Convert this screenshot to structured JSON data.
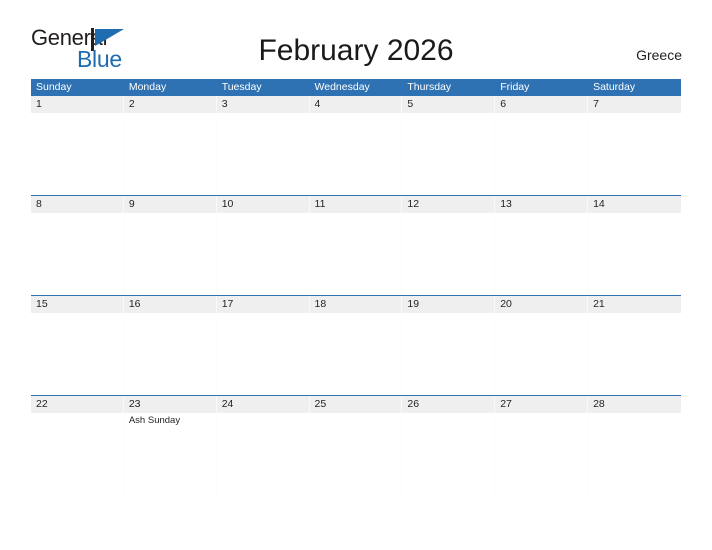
{
  "brand": {
    "name_part1": "General",
    "name_part2": "Blue",
    "flag_icon": "flag-triangle-icon",
    "accent_color": "#1f6cb0"
  },
  "header": {
    "title": "February 2026",
    "region": "Greece"
  },
  "theme": {
    "header_blue": "#2E72B3",
    "date_band_gray": "#EFEFEF",
    "text_dark": "#231f20",
    "page_background": "#ffffff"
  },
  "calendar": {
    "month": "February",
    "year": "2026",
    "weekdays": [
      "Sunday",
      "Monday",
      "Tuesday",
      "Wednesday",
      "Thursday",
      "Friday",
      "Saturday"
    ],
    "weeks": [
      {
        "days": [
          {
            "date": "1",
            "events": []
          },
          {
            "date": "2",
            "events": []
          },
          {
            "date": "3",
            "events": []
          },
          {
            "date": "4",
            "events": []
          },
          {
            "date": "5",
            "events": []
          },
          {
            "date": "6",
            "events": []
          },
          {
            "date": "7",
            "events": []
          }
        ]
      },
      {
        "days": [
          {
            "date": "8",
            "events": []
          },
          {
            "date": "9",
            "events": []
          },
          {
            "date": "10",
            "events": []
          },
          {
            "date": "11",
            "events": []
          },
          {
            "date": "12",
            "events": []
          },
          {
            "date": "13",
            "events": []
          },
          {
            "date": "14",
            "events": []
          }
        ]
      },
      {
        "days": [
          {
            "date": "15",
            "events": []
          },
          {
            "date": "16",
            "events": []
          },
          {
            "date": "17",
            "events": []
          },
          {
            "date": "18",
            "events": []
          },
          {
            "date": "19",
            "events": []
          },
          {
            "date": "20",
            "events": []
          },
          {
            "date": "21",
            "events": []
          }
        ]
      },
      {
        "days": [
          {
            "date": "22",
            "events": []
          },
          {
            "date": "23",
            "events": [
              "Ash Sunday"
            ]
          },
          {
            "date": "24",
            "events": []
          },
          {
            "date": "25",
            "events": []
          },
          {
            "date": "26",
            "events": []
          },
          {
            "date": "27",
            "events": []
          },
          {
            "date": "28",
            "events": []
          }
        ]
      }
    ]
  }
}
